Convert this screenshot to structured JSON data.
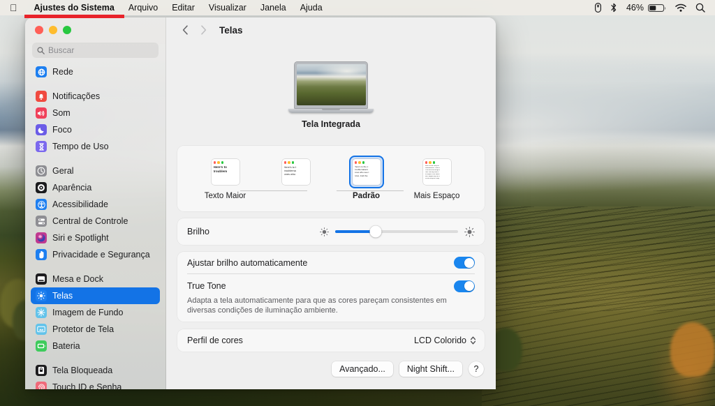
{
  "menubar": {
    "apple_icon": "apple-logo-icon",
    "items": [
      "Ajustes do Sistema",
      "Arquivo",
      "Editar",
      "Visualizar",
      "Janela",
      "Ajuda"
    ],
    "status": {
      "mouse_icon": "mouse-battery-icon",
      "bluetooth_icon": "bluetooth-icon",
      "battery_percent": "46%",
      "battery_icon": "battery-icon",
      "wifi_icon": "wifi-icon",
      "search_icon": "spotlight-search-icon"
    }
  },
  "window": {
    "traffic_lights": [
      "close",
      "minimize",
      "zoom"
    ],
    "search": {
      "placeholder": "Buscar",
      "value": "",
      "icon": "magnifier-icon"
    },
    "sidebar_items": [
      {
        "label": "Rede",
        "icon": "globe-icon",
        "color": "#1d7ff0",
        "selected": false,
        "gap_after": true
      },
      {
        "label": "Notificações",
        "icon": "bell-icon",
        "color": "#f04a3f",
        "selected": false,
        "gap_after": false
      },
      {
        "label": "Som",
        "icon": "speaker-icon",
        "color": "#f0415a",
        "selected": false,
        "gap_after": false
      },
      {
        "label": "Foco",
        "icon": "moon-icon",
        "color": "#6b5ce7",
        "selected": false,
        "gap_after": false
      },
      {
        "label": "Tempo de Uso",
        "icon": "hourglass-icon",
        "color": "#7b68ee",
        "selected": false,
        "gap_after": true
      },
      {
        "label": "Geral",
        "icon": "gear-icon",
        "color": "#8e8e93",
        "selected": false,
        "gap_after": false
      },
      {
        "label": "Aparência",
        "icon": "appearance-icon",
        "color": "#1c1c1e",
        "selected": false,
        "gap_after": false
      },
      {
        "label": "Acessibilidade",
        "icon": "accessibility-icon",
        "color": "#1d7ff0",
        "selected": false,
        "gap_after": false
      },
      {
        "label": "Central de Controle",
        "icon": "control-center-icon",
        "color": "#8e8e93",
        "selected": false,
        "gap_after": false
      },
      {
        "label": "Siri e Spotlight",
        "icon": "siri-icon",
        "color": "#c0398f",
        "selected": false,
        "gap_after": false
      },
      {
        "label": "Privacidade e Segurança",
        "icon": "hand-privacy-icon",
        "color": "#1d7ff0",
        "selected": false,
        "gap_after": true
      },
      {
        "label": "Mesa e Dock",
        "icon": "desktop-dock-icon",
        "color": "#1c1c1e",
        "selected": false,
        "gap_after": false
      },
      {
        "label": "Telas",
        "icon": "brightness-icon",
        "color": "#1d7ff0",
        "selected": true,
        "gap_after": false
      },
      {
        "label": "Imagem de Fundo",
        "icon": "wallpaper-icon",
        "color": "#63c3ea",
        "selected": false,
        "gap_after": false
      },
      {
        "label": "Protetor de Tela",
        "icon": "screensaver-icon",
        "color": "#63c3ea",
        "selected": false,
        "gap_after": false
      },
      {
        "label": "Bateria",
        "icon": "battery-icon",
        "color": "#3ecb5c",
        "selected": false,
        "gap_after": true
      },
      {
        "label": "Tela Bloqueada",
        "icon": "lock-screen-icon",
        "color": "#1c1c1e",
        "selected": false,
        "gap_after": false
      },
      {
        "label": "Touch ID e Senha",
        "icon": "fingerprint-icon",
        "color": "#f06a7a",
        "selected": false,
        "gap_after": false
      }
    ]
  },
  "toolbar": {
    "back_icon": "chevron-left-icon",
    "forward_icon": "chevron-right-icon",
    "title": "Telas"
  },
  "display": {
    "preview_name": "Tela Integrada"
  },
  "scaling": {
    "options": [
      {
        "label": "Texto Maior",
        "selected": false,
        "lines": [
          "Here's to",
          "troublem"
        ]
      },
      {
        "label": "",
        "selected": false,
        "lines": [
          "Here's to t",
          "troublema",
          "ones who"
        ]
      },
      {
        "label": "Padrão",
        "selected": true,
        "lines": [
          "Here's to the c",
          "troublemakers",
          "ones who see t",
          "rules. And the"
        ]
      },
      {
        "label": "Mais Espaço",
        "selected": false,
        "lines": [
          "Here's to the crazy on",
          "troublemakers. There a",
          "a can who see things d",
          "rules. not they have n",
          "no respect if the status",
          "men. Maybe they can c",
          "the one they are crazy"
        ]
      }
    ]
  },
  "brightness": {
    "label": "Brilho",
    "value_percent": 33,
    "min_icon": "low-brightness-icon",
    "max_icon": "high-brightness-icon",
    "highlighted": true,
    "highlight_color": "#e8232a"
  },
  "toggles": [
    {
      "label": "Ajustar brilho automaticamente",
      "description": "",
      "on": true
    },
    {
      "label": "True Tone",
      "description": "Adapta a tela automaticamente para que as cores pareçam consistentes em diversas condições de iluminação ambiente.",
      "on": true
    }
  ],
  "color_profile": {
    "label": "Perfil de cores",
    "value": "LCD Colorido",
    "chevron_icon": "chevron-updown-icon"
  },
  "buttons": {
    "advanced": "Avançado...",
    "night_shift": "Night Shift...",
    "help": "?"
  },
  "colors": {
    "accent": "#1373e6",
    "toggle_on": "#1a86ee",
    "highlight": "#e8232a"
  }
}
